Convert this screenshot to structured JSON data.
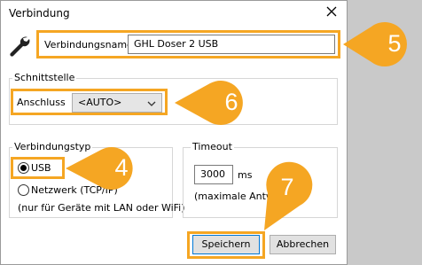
{
  "window": {
    "title": "Verbindung"
  },
  "connection_name": {
    "label": "Verbindungsname",
    "value": "GHL Doser 2 USB"
  },
  "interface": {
    "group_title": "Schnittstelle",
    "port_label": "Anschluss",
    "port_value": "<AUTO>"
  },
  "connection_type": {
    "group_title": "Verbindungstyp",
    "options": [
      {
        "label": "USB",
        "selected": true
      },
      {
        "label": "Netzwerk (TCP/IP)",
        "selected": false
      }
    ],
    "note": "(nur für Geräte mit LAN oder WiFi)"
  },
  "timeout": {
    "group_title": "Timeout",
    "value": "3000",
    "unit": "ms",
    "max_label": "(maximale Antwort"
  },
  "buttons": {
    "save": "Speichern",
    "cancel": "Abbrechen"
  },
  "callouts": [
    "5",
    "6",
    "4",
    "7"
  ],
  "colors": {
    "highlight": "#f5a623",
    "callout": "#f5a623",
    "dialog_bg": "#ffffff",
    "outer_bg": "#c9c9c9"
  },
  "icons": {
    "close": "close-icon",
    "settings": "wrench-icon",
    "dropdown": "chevron-down-icon"
  }
}
